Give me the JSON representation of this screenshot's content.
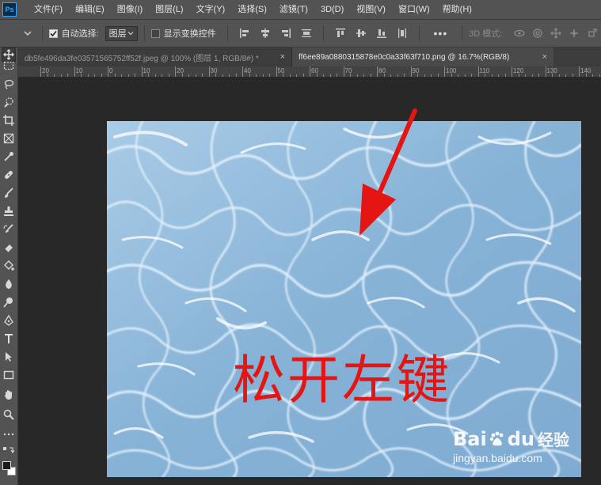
{
  "app": {
    "logo": "Ps"
  },
  "menu": [
    "文件(F)",
    "编辑(E)",
    "图像(I)",
    "图层(L)",
    "文字(Y)",
    "选择(S)",
    "滤镜(T)",
    "3D(D)",
    "视图(V)",
    "窗口(W)",
    "帮助(H)"
  ],
  "options": {
    "auto_select_label": "自动选择:",
    "auto_select_checked": true,
    "auto_select_value": "图层",
    "show_transform_label": "显示变换控件",
    "show_transform_checked": false,
    "more": "•••",
    "mode_3d": "3D 模式:"
  },
  "tabs": [
    {
      "label": "db5fe496da3fe03571565752ff52f.jpeg @ 100% (图层 1, RGB/8#) *",
      "close": "×",
      "active": false
    },
    {
      "label": "ff6ee89a0880315878e0c0a33f63f710.png @ 16.7%(RGB/8)",
      "close": "×",
      "active": true
    }
  ],
  "ruler": {
    "labels": [
      "20",
      "10",
      "0",
      "10",
      "20",
      "30",
      "40",
      "50",
      "60",
      "70",
      "80",
      "90",
      "100",
      "110",
      "120",
      "130",
      "140"
    ]
  },
  "canvas": {
    "annotation_text": "松开左键",
    "annotation_color": "#e41512",
    "water_color": "#8eb7d8"
  },
  "watermark": {
    "brand_a": "Bai",
    "brand_b": "du",
    "brand_c": "经验",
    "url": "jingyan.baidu.com"
  },
  "colors": {
    "foreground": "#1b1b1b",
    "background": "#ffffff",
    "ui_panel": "#535353",
    "workspace": "#282828"
  }
}
